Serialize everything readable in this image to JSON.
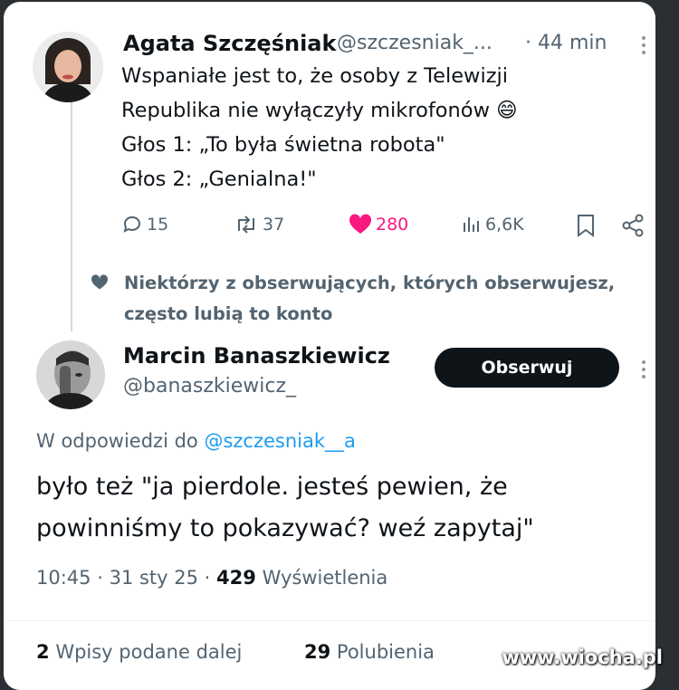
{
  "tweet1": {
    "author_name": "Agata Szczęśniak",
    "handle": "@szczesniak_...",
    "time": "· 44 min",
    "lines": [
      "Wspaniałe jest to, że osoby z Telewizji",
      "Republika nie wyłączyły mikrofonów 😄",
      "Głos 1: „To była świetna robota\"",
      "Głos 2: „Genialna!\""
    ],
    "replies": "15",
    "reposts": "37",
    "likes": "280",
    "views": "6,6K"
  },
  "social_context": {
    "line1": "Niektórzy z obserwujących, których obserwujesz,",
    "line2": "często lubią to konto"
  },
  "tweet2": {
    "author_name": "Marcin Banaszkiewicz",
    "handle": "@banaszkiewicz_",
    "follow_label": "Obserwuj",
    "reply_prefix": "W odpowiedzi do",
    "reply_to": "@szczesniak__a",
    "text_line1": "było też \"ja pierdole. jesteś pewien, że",
    "text_line2": "powinniśmy to pokazywać? weź zapytaj\"",
    "time": "10:45",
    "date": "31 sty 25",
    "views_count": "429",
    "views_label": "Wyświetlenia",
    "reposts_count": "2",
    "reposts_label": "Wpisy podane dalej",
    "likes_count": "29",
    "likes_label": "Polubienia"
  },
  "watermark": "www.wiocha.pl",
  "colors": {
    "like_pink": "#f91880",
    "muted": "#536471",
    "link_blue": "#1d9bf0",
    "button_black": "#0f1419"
  }
}
